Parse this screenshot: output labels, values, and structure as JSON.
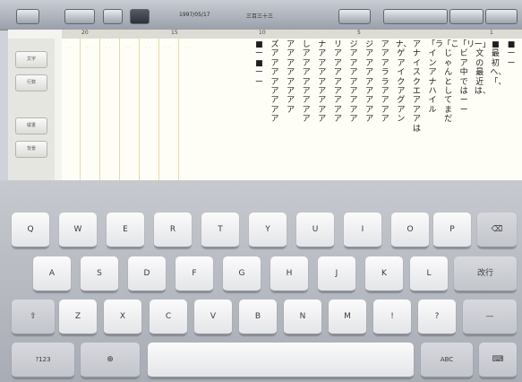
{
  "toolbar": {
    "btn1": "",
    "btn2": "",
    "btn3": "",
    "btn4": "",
    "title1": "1997/05/17",
    "title2": "三百三十三",
    "btn5": "",
    "btn6": "",
    "btn7": "",
    "btn8": ""
  },
  "ruler": [
    "20",
    "15",
    "10",
    "5",
    "1"
  ],
  "side_buttons": [
    "文字",
    "行数",
    "縦書",
    "背景"
  ],
  "page_columns": [
    "■ーー",
    "■最初へ、「、",
    "ー」文の最近は、",
    "「リビア中ではーー",
    "「こじゃんとしてまだ",
    "「ラインアナハイル",
    "アナイスクエアアアは",
    "ナ、ゲアイクアグアン",
    "アアアララアアアア",
    "ジアアアアアアアア",
    "ジアアアアアアアア",
    "リアアアアアアアア",
    "ナアアアアアアアア",
    "しアアアアアアアア",
    "アアアアアアアア",
    "ズアアアアアアアア",
    "■ー■ーー"
  ],
  "keyboard": {
    "row1": [
      "Q",
      "W",
      "E",
      "R",
      "T",
      "Y",
      "U",
      "I",
      "O",
      "P"
    ],
    "backspace": "⌫",
    "row2": [
      "A",
      "S",
      "D",
      "F",
      "G",
      "H",
      "J",
      "K",
      "L"
    ],
    "return": "改行",
    "shift": "⇧",
    "row3": [
      "Z",
      "X",
      "C",
      "V",
      "B",
      "N",
      "M",
      "!",
      "?"
    ],
    "dash": "—",
    "numbers": "?123",
    "globe": "⊕",
    "space": "",
    "abc": "ABC",
    "hide": "⌨"
  }
}
